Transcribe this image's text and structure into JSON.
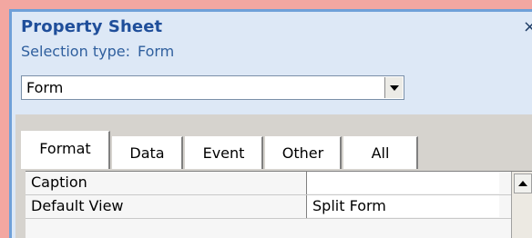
{
  "panel": {
    "title": "Property Sheet",
    "close_glyph": "×",
    "selection_label": "Selection type:",
    "selection_value": "Form"
  },
  "object_combo": {
    "value": "Form"
  },
  "tabs": [
    {
      "label": "Format",
      "active": true
    },
    {
      "label": "Data",
      "active": false
    },
    {
      "label": "Event",
      "active": false
    },
    {
      "label": "Other",
      "active": false
    },
    {
      "label": "All",
      "active": false
    }
  ],
  "properties": [
    {
      "name": "Caption",
      "value": ""
    },
    {
      "name": "Default View",
      "value": "Split Form"
    }
  ],
  "colors": {
    "frame_accent": "#f3a7a1",
    "title_text": "#1f4e9a",
    "selection_text": "#2f5f9e",
    "panel_bg": "#dde8f6"
  },
  "icons": {
    "close": "close-icon",
    "combo_dropdown": "chevron-down-icon",
    "scroll_up": "arrow-up-icon"
  }
}
